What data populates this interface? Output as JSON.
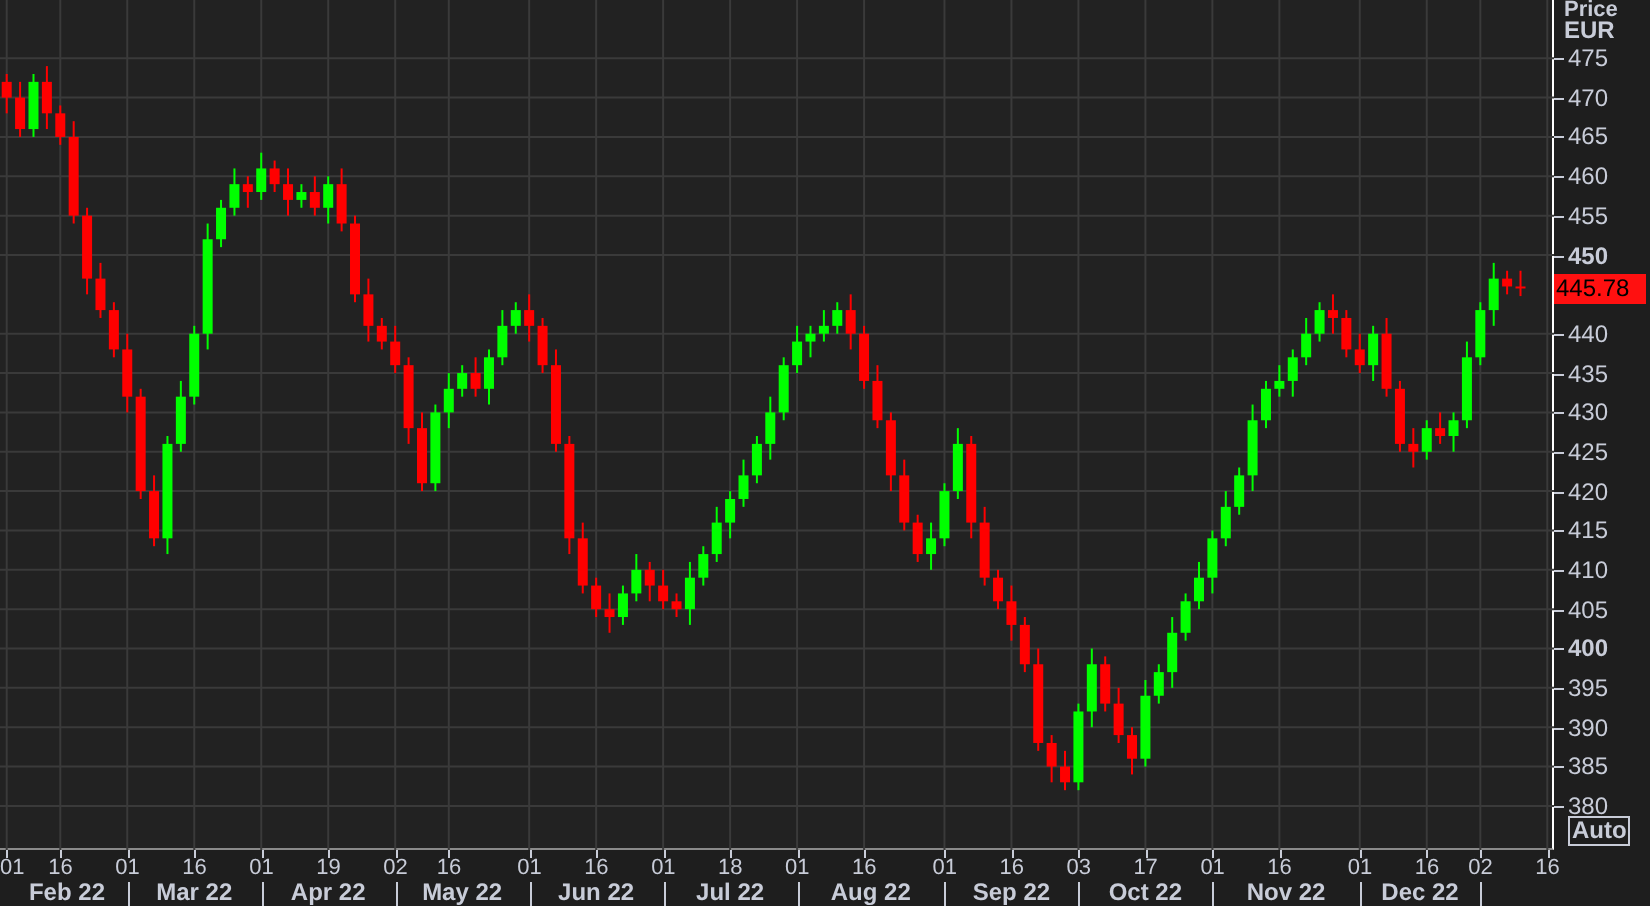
{
  "axis_header": {
    "currency": "EUR"
  },
  "last_price": "445.78",
  "scale_button": "Auto",
  "months": [
    "Feb 22",
    "Mar 22",
    "Apr 22",
    "May 22",
    "Jun 22",
    "Jul 22",
    "Aug 22",
    "Sep 22",
    "Oct 22",
    "Nov 22",
    "Dec 22"
  ],
  "chart_data": {
    "type": "candlestick",
    "ylabel": "Price",
    "ylim": [
      374.4,
      482.4
    ],
    "grid": true,
    "yticks": [
      380,
      385,
      390,
      395,
      400,
      405,
      410,
      415,
      420,
      425,
      430,
      435,
      440,
      450,
      455,
      460,
      465,
      470,
      475
    ],
    "categories": [
      "01",
      null,
      null,
      null,
      "16",
      null,
      null,
      null,
      null,
      "01",
      null,
      null,
      null,
      null,
      "16",
      null,
      null,
      null,
      null,
      "01",
      null,
      null,
      null,
      null,
      "19",
      null,
      null,
      null,
      null,
      "02",
      null,
      null,
      null,
      "16",
      null,
      null,
      null,
      null,
      null,
      "01",
      null,
      null,
      null,
      null,
      "16",
      null,
      null,
      null,
      null,
      "01",
      null,
      null,
      null,
      null,
      "18",
      null,
      null,
      null,
      null,
      "01",
      null,
      null,
      null,
      null,
      "16",
      null,
      null,
      null,
      null,
      null,
      "01",
      null,
      null,
      null,
      null,
      "16",
      null,
      null,
      null,
      null,
      "03",
      null,
      null,
      null,
      null,
      "17",
      null,
      null,
      null,
      null,
      "01",
      null,
      null,
      null,
      null,
      "16",
      null,
      null,
      null,
      null,
      null,
      "01",
      null,
      null,
      null,
      null,
      "16",
      null,
      null,
      null,
      "02",
      null,
      null,
      null,
      null,
      "16"
    ],
    "ohlc": [
      [
        472,
        473,
        468,
        470
      ],
      [
        470,
        472,
        465,
        466
      ],
      [
        466,
        473,
        465,
        472
      ],
      [
        472,
        474,
        466,
        468
      ],
      [
        468,
        469,
        464,
        465
      ],
      [
        465,
        467,
        454,
        455
      ],
      [
        455,
        456,
        445,
        447
      ],
      [
        447,
        449,
        442,
        443
      ],
      [
        443,
        444,
        437,
        438
      ],
      [
        438,
        440,
        430,
        432
      ],
      [
        432,
        433,
        419,
        420
      ],
      [
        420,
        422,
        413,
        414
      ],
      [
        414,
        427,
        412,
        426
      ],
      [
        426,
        434,
        425,
        432
      ],
      [
        432,
        441,
        431,
        440
      ],
      [
        440,
        454,
        438,
        452
      ],
      [
        452,
        457,
        451,
        456
      ],
      [
        456,
        461,
        455,
        459
      ],
      [
        459,
        460,
        456,
        458
      ],
      [
        458,
        463,
        457,
        461
      ],
      [
        461,
        462,
        458,
        459
      ],
      [
        459,
        461,
        455,
        457
      ],
      [
        457,
        459,
        456,
        458
      ],
      [
        458,
        460,
        455,
        456
      ],
      [
        456,
        460,
        454,
        459
      ],
      [
        459,
        461,
        453,
        454
      ],
      [
        454,
        455,
        444,
        445
      ],
      [
        445,
        447,
        439,
        441
      ],
      [
        441,
        442,
        438,
        439
      ],
      [
        439,
        441,
        435,
        436
      ],
      [
        436,
        437,
        426,
        428
      ],
      [
        428,
        430,
        420,
        421
      ],
      [
        421,
        431,
        420,
        430
      ],
      [
        430,
        435,
        428,
        433
      ],
      [
        433,
        436,
        432,
        435
      ],
      [
        435,
        437,
        432,
        433
      ],
      [
        433,
        438,
        431,
        437
      ],
      [
        437,
        443,
        436,
        441
      ],
      [
        441,
        444,
        440,
        443
      ],
      [
        443,
        445,
        439,
        441
      ],
      [
        441,
        442,
        435,
        436
      ],
      [
        436,
        438,
        425,
        426
      ],
      [
        426,
        427,
        412,
        414
      ],
      [
        414,
        416,
        407,
        408
      ],
      [
        408,
        409,
        404,
        405
      ],
      [
        405,
        407,
        402,
        404
      ],
      [
        404,
        408,
        403,
        407
      ],
      [
        407,
        412,
        406,
        410
      ],
      [
        410,
        411,
        406,
        408
      ],
      [
        408,
        410,
        405,
        406
      ],
      [
        406,
        407,
        404,
        405
      ],
      [
        405,
        411,
        403,
        409
      ],
      [
        409,
        413,
        408,
        412
      ],
      [
        412,
        418,
        411,
        416
      ],
      [
        416,
        420,
        414,
        419
      ],
      [
        419,
        424,
        418,
        422
      ],
      [
        422,
        427,
        421,
        426
      ],
      [
        426,
        432,
        424,
        430
      ],
      [
        430,
        437,
        429,
        436
      ],
      [
        436,
        441,
        435,
        439
      ],
      [
        439,
        441,
        437,
        440
      ],
      [
        440,
        443,
        439,
        441
      ],
      [
        441,
        444,
        440,
        443
      ],
      [
        443,
        445,
        438,
        440
      ],
      [
        440,
        441,
        433,
        434
      ],
      [
        434,
        436,
        428,
        429
      ],
      [
        429,
        430,
        420,
        422
      ],
      [
        422,
        424,
        415,
        416
      ],
      [
        416,
        417,
        411,
        412
      ],
      [
        412,
        416,
        410,
        414
      ],
      [
        414,
        421,
        413,
        420
      ],
      [
        420,
        428,
        419,
        426
      ],
      [
        426,
        427,
        414,
        416
      ],
      [
        416,
        418,
        408,
        409
      ],
      [
        409,
        410,
        405,
        406
      ],
      [
        406,
        408,
        401,
        403
      ],
      [
        403,
        404,
        397,
        398
      ],
      [
        398,
        400,
        387,
        388
      ],
      [
        388,
        389,
        383,
        385
      ],
      [
        385,
        387,
        382,
        383
      ],
      [
        383,
        393,
        382,
        392
      ],
      [
        392,
        400,
        390,
        398
      ],
      [
        398,
        399,
        392,
        393
      ],
      [
        393,
        395,
        388,
        389
      ],
      [
        389,
        390,
        384,
        386
      ],
      [
        386,
        396,
        385,
        394
      ],
      [
        394,
        398,
        393,
        397
      ],
      [
        397,
        404,
        395,
        402
      ],
      [
        402,
        407,
        401,
        406
      ],
      [
        406,
        411,
        405,
        409
      ],
      [
        409,
        415,
        407,
        414
      ],
      [
        414,
        420,
        413,
        418
      ],
      [
        418,
        423,
        417,
        422
      ],
      [
        422,
        431,
        420,
        429
      ],
      [
        429,
        434,
        428,
        433
      ],
      [
        433,
        436,
        432,
        434
      ],
      [
        434,
        438,
        432,
        437
      ],
      [
        437,
        442,
        436,
        440
      ],
      [
        440,
        444,
        439,
        443
      ],
      [
        443,
        445,
        440,
        442
      ],
      [
        442,
        443,
        437,
        438
      ],
      [
        438,
        440,
        435,
        436
      ],
      [
        436,
        441,
        434,
        440
      ],
      [
        440,
        442,
        432,
        433
      ],
      [
        433,
        434,
        425,
        426
      ],
      [
        426,
        428,
        423,
        425
      ],
      [
        425,
        429,
        424,
        428
      ],
      [
        428,
        430,
        426,
        427
      ],
      [
        427,
        430,
        425,
        429
      ],
      [
        429,
        439,
        428,
        437
      ],
      [
        437,
        444,
        436,
        443
      ],
      [
        443,
        449,
        441,
        447
      ],
      [
        447,
        448,
        445,
        446
      ],
      [
        446,
        448,
        444.78,
        445.78
      ],
      null,
      null
    ]
  }
}
